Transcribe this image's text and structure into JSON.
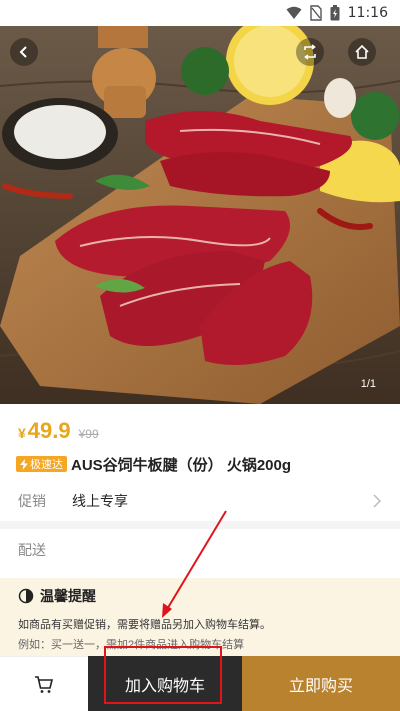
{
  "status_bar": {
    "time": "11:16"
  },
  "hero": {
    "pager": "1/1"
  },
  "product": {
    "price_symbol": "¥",
    "price": "49.9",
    "original_price": "¥99",
    "express_badge": "极速达",
    "title": "AUS谷饲牛板腱（份） 火锅200g"
  },
  "promotion": {
    "label": "促销",
    "value": "线上专享"
  },
  "delivery": {
    "label": "配送"
  },
  "notice": {
    "title": "温馨提醒",
    "line1": "如商品有买赠促销，需要将赠品另加入购物车结算。",
    "line2": "例如：买一送一，需加2件商品进入购物车结算"
  },
  "bottom_bar": {
    "add_to_cart": "加入购物车",
    "buy_now": "立即购买"
  },
  "colors": {
    "price": "#e8a61b",
    "add_to_cart_bg": "#2b2b2b",
    "buy_now_bg": "#b9822e",
    "notice_bg": "#fbf4e3",
    "annotation": "#e0141b"
  }
}
